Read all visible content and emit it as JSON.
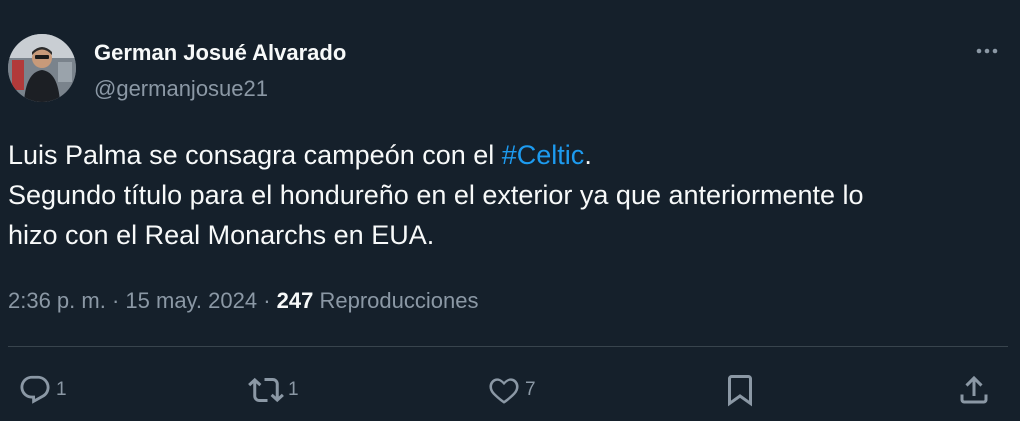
{
  "user": {
    "display_name": "German Josué Alvarado",
    "handle": "@germanjosue21",
    "avatar_icon": "profile-photo"
  },
  "tweet": {
    "line1_before": "Luis Palma se consagra campeón con el ",
    "hashtag": "#Celtic",
    "line1_after": ".",
    "line2": "Segundo título para el hondureño en el exterior ya que anteriormente lo",
    "line3": "hizo con el Real Monarchs en EUA."
  },
  "meta": {
    "time": "2:36 p. m.",
    "separator1": " · ",
    "date": "15 may. 2024",
    "separator2": " · ",
    "views": "247",
    "views_label": " Reproducciones"
  },
  "actions": {
    "replies": "1",
    "retweets": "1",
    "likes": "7"
  },
  "icons": {
    "more": "more-horizontal-icon",
    "reply": "reply-icon",
    "retweet": "retweet-icon",
    "like": "heart-icon",
    "bookmark": "bookmark-icon",
    "share": "share-icon"
  },
  "colors": {
    "background": "#15202b",
    "text": "#f7f9f9",
    "secondary": "#8b98a5",
    "accent": "#1d9bf0",
    "divider": "#38444d"
  }
}
